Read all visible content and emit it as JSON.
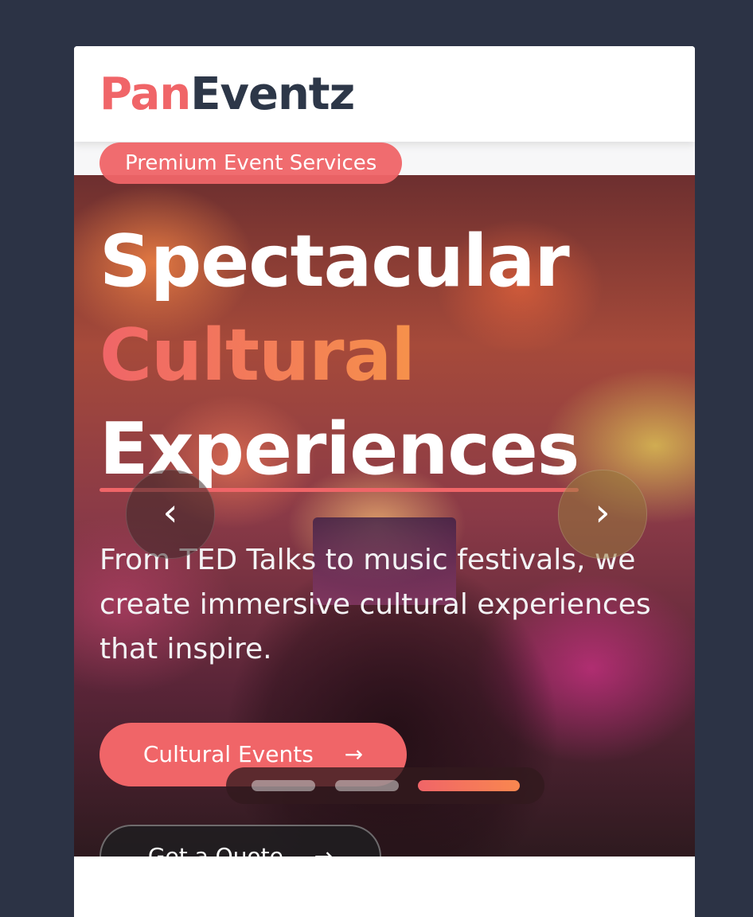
{
  "brand": {
    "part1": "Pan",
    "part2": "Eventz",
    "color_primary": "#f06568",
    "color_dark": "#2d3748"
  },
  "hero": {
    "badge": "Premium Event Services",
    "headline_line1": "Spectacular",
    "headline_line2": "Cultural",
    "headline_line3": "Experiences",
    "description": "From TED Talks to music festivals, we create immersive cultural experiences that inspire.",
    "primary_cta": "Cultural Events",
    "primary_cta_icon": "arrow-right-icon",
    "secondary_cta": "Get a Quote",
    "secondary_cta_icon": "arrow-right-icon",
    "background_image": "concert-crowd-photo"
  },
  "carousel": {
    "prev_icon": "chevron-left-icon",
    "next_icon": "chevron-right-icon",
    "slide_count": 3,
    "active_slide": 3
  },
  "colors": {
    "page_background": "#2c3345",
    "accent_gradient_start": "#f06568",
    "accent_gradient_end": "#f9a83b"
  }
}
